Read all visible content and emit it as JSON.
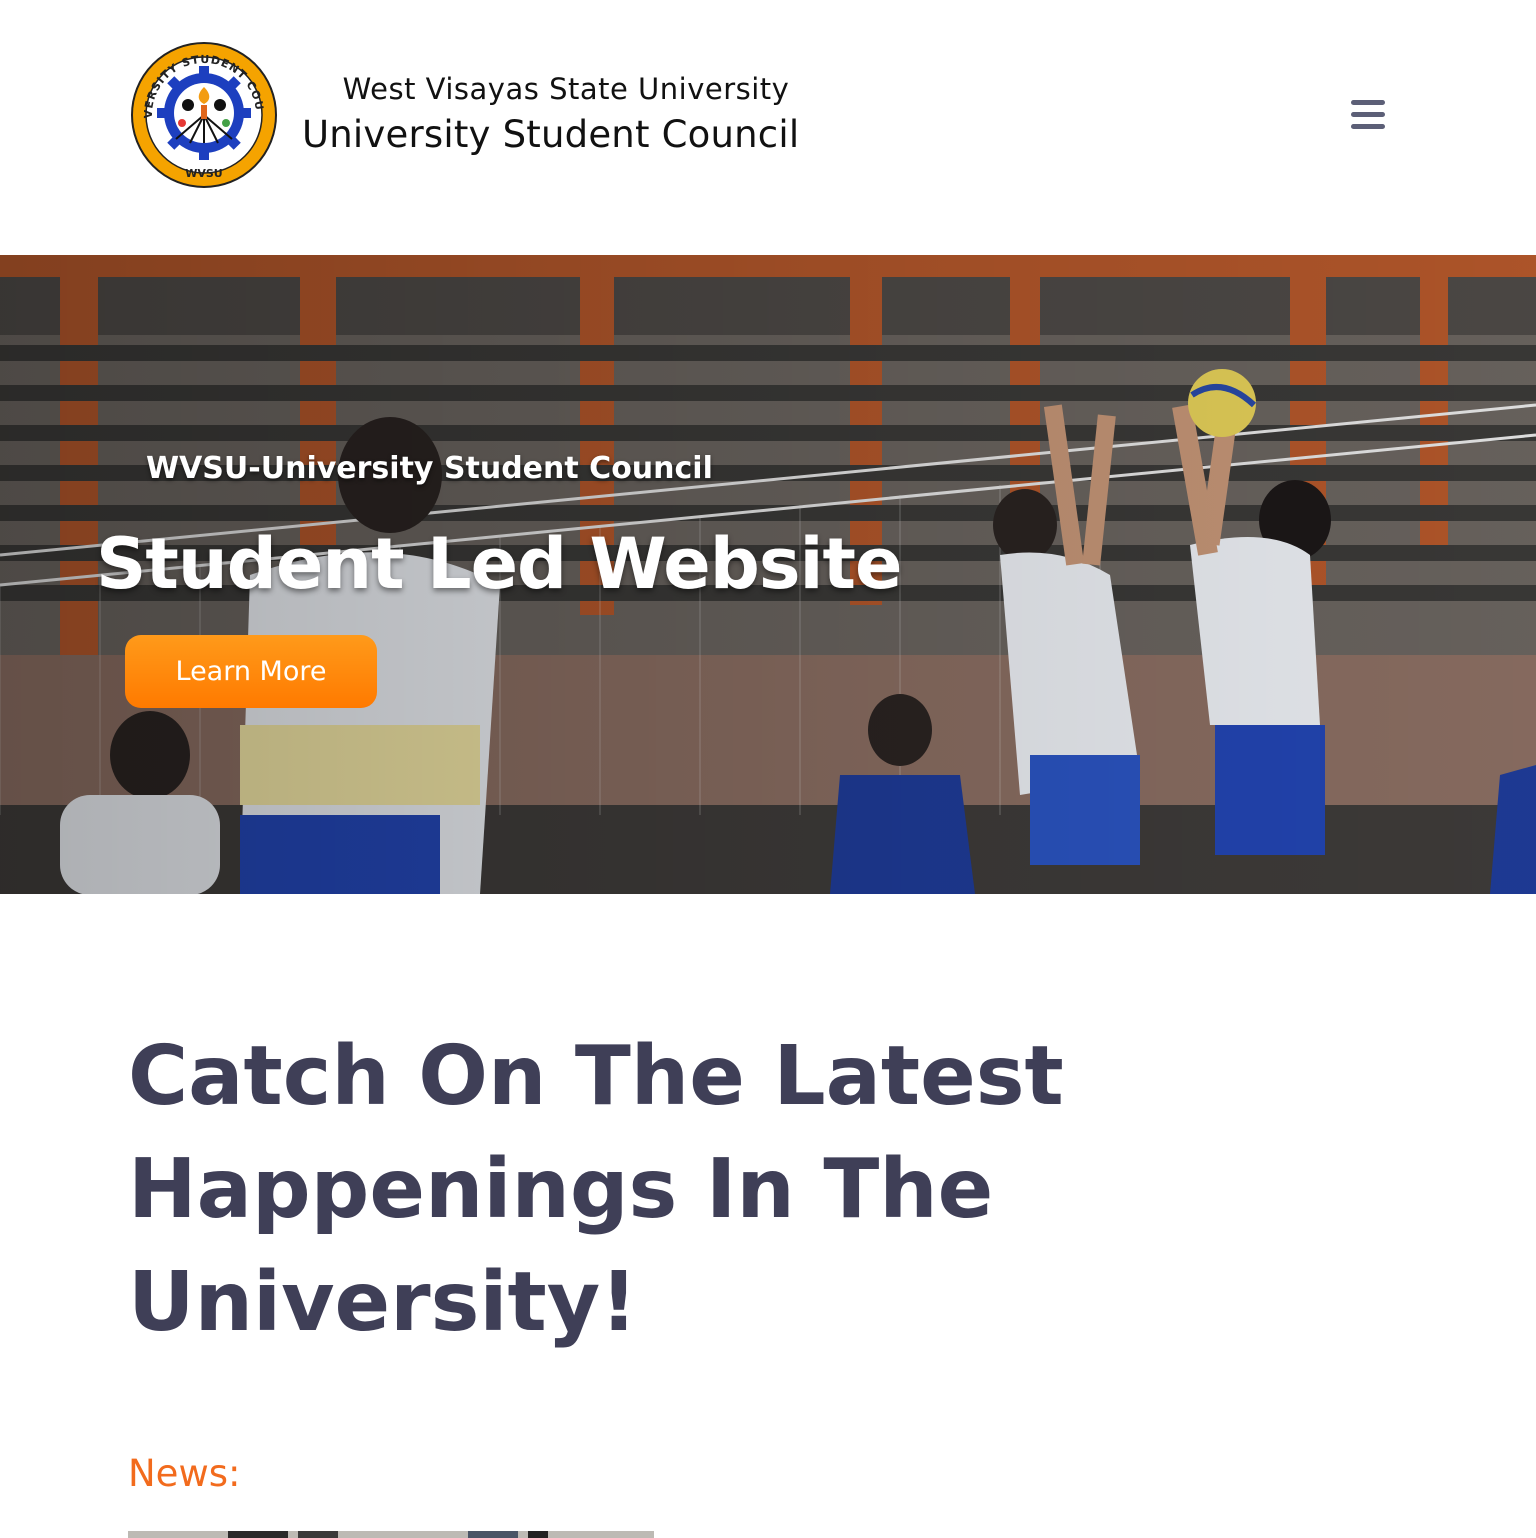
{
  "header": {
    "logo": {
      "ring_text_top": "UNIVERSITY STUDENT COUNCIL",
      "ring_text_bottom": "WVSU",
      "ring_color": "#f5a300",
      "inner_color": "#1d3fbf"
    },
    "subtitle": "West Visayas State University",
    "title": "University Student Council",
    "menu_icon": "hamburger-menu-icon"
  },
  "hero": {
    "kicker": "WVSU-University Student Council",
    "title": "Student Led Website",
    "cta_label": "Learn More",
    "cta_color": "#ff8a00"
  },
  "latest": {
    "heading": "Catch On The Latest Happenings In The University!",
    "heading_color": "#3f3f57"
  },
  "news": {
    "label": "News:",
    "label_color": "#f26b1d"
  }
}
